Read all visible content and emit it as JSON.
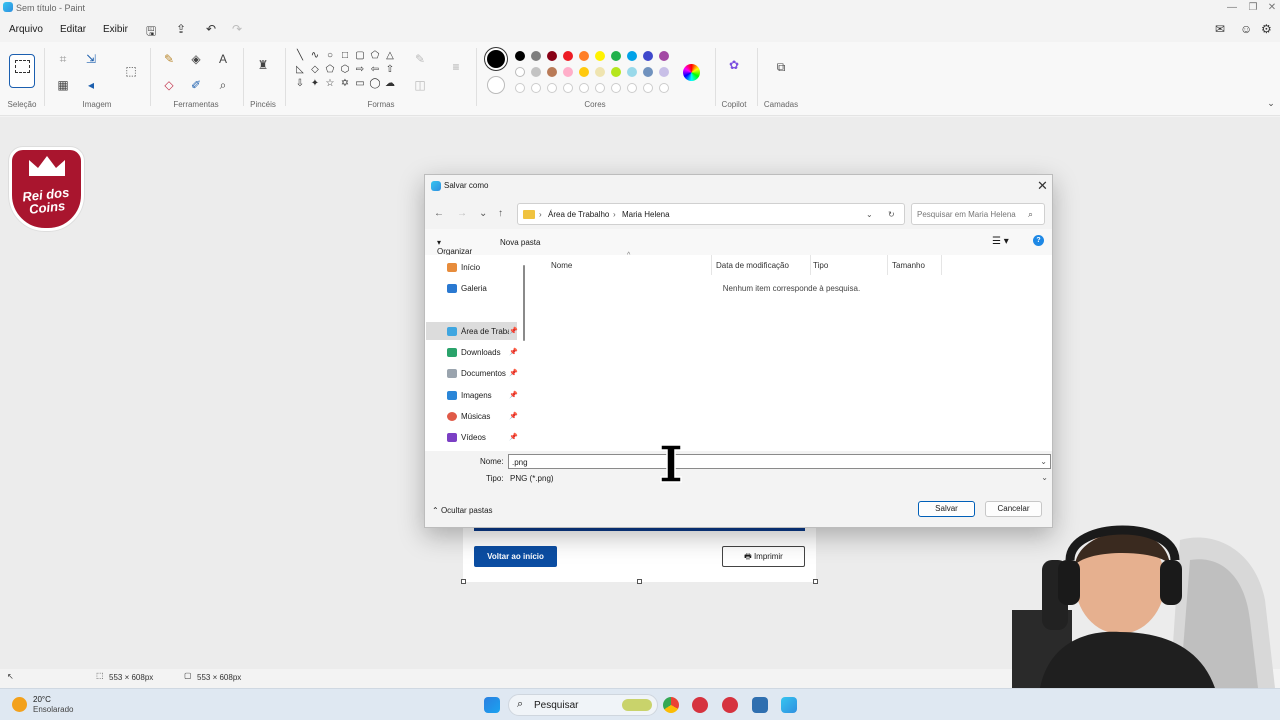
{
  "window": {
    "title": "Sem título - Paint"
  },
  "menu": [
    "Arquivo",
    "Editar",
    "Exibir"
  ],
  "ribbon": {
    "groups": {
      "selection": "Seleção",
      "image": "Imagem",
      "tools": "Ferramentas",
      "brushes": "Pincéis",
      "shapes": "Formas",
      "colors": "Cores",
      "copilot": "Copilot",
      "layers": "Camadas"
    },
    "colors_row1": [
      "#000000",
      "#7f7f7f",
      "#880015",
      "#ed1c24",
      "#ff7f27",
      "#fff200",
      "#22b14c",
      "#00a2e8",
      "#3f48cc",
      "#a349a4"
    ],
    "colors_row2": [
      "#ffffff",
      "#c3c3c3",
      "#b97a57",
      "#ffaec9",
      "#ffc90e",
      "#efe4b0",
      "#b5e61d",
      "#99d9ea",
      "#7092be",
      "#c8bfe7"
    ]
  },
  "canvas": {
    "home_button": "Voltar ao início",
    "print_button": "Imprimir",
    "logo_text": "Rei dos Coins"
  },
  "dialog": {
    "title": "Salvar como",
    "breadcrumb": [
      "Área de Trabalho",
      "Maria Helena"
    ],
    "search_placeholder": "Pesquisar em Maria Helena",
    "organize": "Organizar",
    "new_folder": "Nova pasta",
    "nav": [
      {
        "label": "Início",
        "pinned": false
      },
      {
        "label": "Galeria",
        "pinned": false
      },
      {
        "label": "Área de Trabalho",
        "pinned": true
      },
      {
        "label": "Downloads",
        "pinned": true
      },
      {
        "label": "Documentos",
        "pinned": true
      },
      {
        "label": "Imagens",
        "pinned": true
      },
      {
        "label": "Músicas",
        "pinned": true
      },
      {
        "label": "Vídeos",
        "pinned": true
      }
    ],
    "columns": [
      "Nome",
      "Data de modificação",
      "Tipo",
      "Tamanho"
    ],
    "empty_message": "Nenhum item corresponde à pesquisa.",
    "name_label": "Nome:",
    "name_value": ".png",
    "type_label": "Tipo:",
    "type_value": "PNG (*.png)",
    "hide_folders": "Ocultar pastas",
    "save": "Salvar",
    "cancel": "Cancelar"
  },
  "status": {
    "selection_size": "553 × 608px",
    "canvas_size": "553 × 608px"
  },
  "taskbar": {
    "temperature": "20°C",
    "weather": "Ensolarado",
    "search": "Pesquisar"
  }
}
